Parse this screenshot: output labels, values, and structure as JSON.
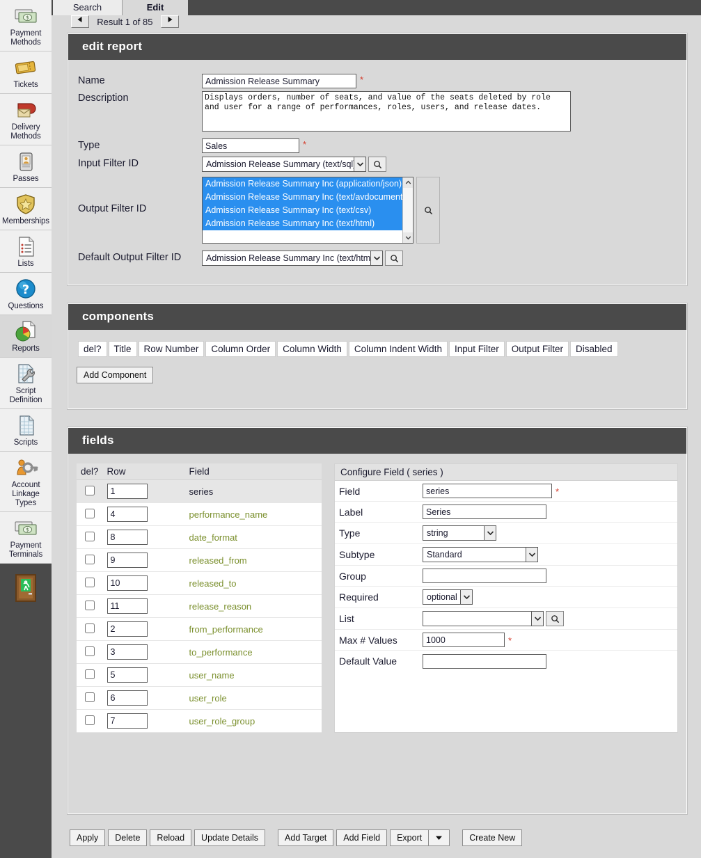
{
  "sidebar": {
    "items": [
      {
        "label": "Payment Methods",
        "icon": "banknotes-icon",
        "selected": false
      },
      {
        "label": "Tickets",
        "icon": "ticket-icon",
        "selected": false
      },
      {
        "label": "Delivery Methods",
        "icon": "mailbox-icon",
        "selected": false
      },
      {
        "label": "Passes",
        "icon": "pass-card-icon",
        "selected": false
      },
      {
        "label": "Memberships",
        "icon": "shield-star-icon",
        "selected": false
      },
      {
        "label": "Lists",
        "icon": "list-document-icon",
        "selected": false
      },
      {
        "label": "Questions",
        "icon": "question-mark-icon",
        "selected": false
      },
      {
        "label": "Reports",
        "icon": "pie-chart-document-icon",
        "selected": true
      },
      {
        "label": "Script Definition",
        "icon": "grid-wrench-icon",
        "selected": false
      },
      {
        "label": "Scripts",
        "icon": "grid-document-icon",
        "selected": false
      },
      {
        "label": "Account Linkage Types",
        "icon": "person-key-icon",
        "selected": false
      },
      {
        "label": "Payment Terminals",
        "icon": "banknotes-icon",
        "selected": false
      }
    ],
    "exit_icon": "exit-door-icon"
  },
  "tabs": [
    {
      "label": "Search",
      "active": false
    },
    {
      "label": "Edit",
      "active": true
    }
  ],
  "result_nav": {
    "prev_icon": "triangle-left-icon",
    "next_icon": "triangle-right-icon",
    "text": "Result 1 of 85"
  },
  "edit_report": {
    "title": "edit report",
    "labels": {
      "name": "Name",
      "description": "Description",
      "type": "Type",
      "input_filter_id": "Input Filter ID",
      "output_filter_id": "Output Filter ID",
      "default_output_filter_id": "Default Output Filter ID"
    },
    "required_marker": "*",
    "name_value": "Admission Release Summary",
    "description_value": "Displays orders, number of seats, and value of the seats deleted by role and user for a range of performances, roles, users, and release dates.",
    "type_value": "Sales",
    "input_filter_value": "Admission Release Summary (text/sql)",
    "output_filter_options": [
      "Admission Release Summary Inc (application/json)",
      "Admission Release Summary Inc (text/avdocument)",
      "Admission Release Summary Inc (text/csv)",
      "Admission Release Summary Inc (text/html)"
    ],
    "default_output_filter_value": "Admission Release Summary Inc (text/html)",
    "search_icon": "magnifier-icon",
    "dropdown_icon": "chevron-down-icon"
  },
  "components": {
    "title": "components",
    "columns": [
      "del?",
      "Title",
      "Row Number",
      "Column Order",
      "Column Width",
      "Column Indent Width",
      "Input Filter",
      "Output Filter",
      "Disabled"
    ],
    "add_button": "Add Component"
  },
  "fields": {
    "title": "fields",
    "columns": [
      "del?",
      "Row",
      "Field"
    ],
    "rows": [
      {
        "row": "1",
        "field": "series",
        "selected": true
      },
      {
        "row": "4",
        "field": "performance_name",
        "selected": false
      },
      {
        "row": "8",
        "field": "date_format",
        "selected": false
      },
      {
        "row": "9",
        "field": "released_from",
        "selected": false
      },
      {
        "row": "10",
        "field": "released_to",
        "selected": false
      },
      {
        "row": "11",
        "field": "release_reason",
        "selected": false
      },
      {
        "row": "2",
        "field": "from_performance",
        "selected": false
      },
      {
        "row": "3",
        "field": "to_performance",
        "selected": false
      },
      {
        "row": "5",
        "field": "user_name",
        "selected": false
      },
      {
        "row": "6",
        "field": "user_role",
        "selected": false
      },
      {
        "row": "7",
        "field": "user_role_group",
        "selected": false
      }
    ]
  },
  "configure_field": {
    "title": "Configure Field ( series )",
    "labels": {
      "field": "Field",
      "label": "Label",
      "type": "Type",
      "subtype": "Subtype",
      "group": "Group",
      "required": "Required",
      "list": "List",
      "max_values": "Max # Values",
      "default_value": "Default Value"
    },
    "field_value": "series",
    "label_value": "Series",
    "type_value": "string",
    "subtype_value": "Standard",
    "group_value": "",
    "required_value": "optional",
    "list_value": "",
    "max_values_value": "1000",
    "default_value_value": "",
    "required_marker": "*",
    "search_icon": "magnifier-icon",
    "dropdown_icon": "chevron-down-icon"
  },
  "bottom_buttons": [
    "Apply",
    "Delete",
    "Reload",
    "Update Details",
    "Add Target",
    "Add Field",
    "Export",
    "Create New"
  ],
  "export_dropdown_icon": "caret-down-icon",
  "colors": {
    "panel_header": "#4a4a4a",
    "body_bg": "#d9d9d9",
    "selection_blue": "#2a8fef",
    "field_green": "#7a8f2c",
    "required_red": "#d43a2a"
  }
}
